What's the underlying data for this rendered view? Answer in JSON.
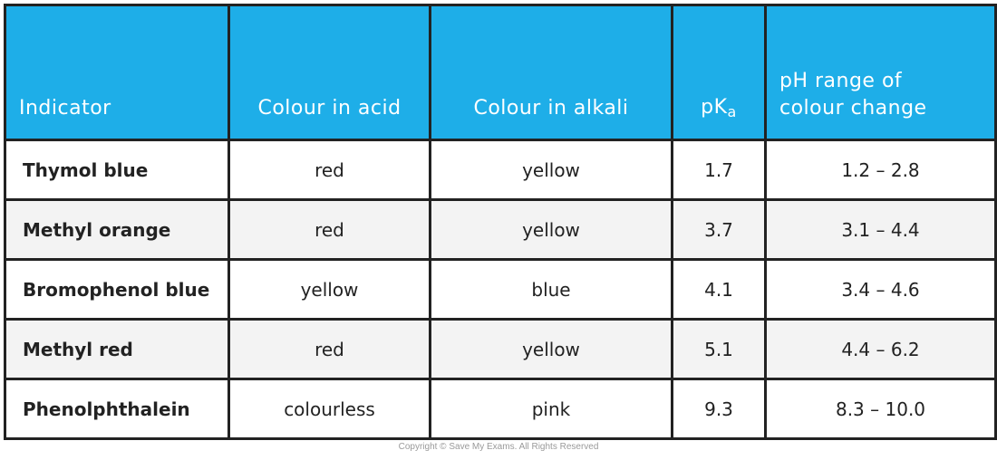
{
  "table": {
    "header_color": "#1eaee8",
    "headers": {
      "indicator": "Indicator",
      "colour_acid": "Colour in acid",
      "colour_alkali": "Colour in alkali",
      "pka_main": "pK",
      "pka_sub": "a",
      "ph_range_line1": "pH range of",
      "ph_range_line2": "colour change"
    },
    "rows": [
      {
        "indicator": "Thymol blue",
        "acid": "red",
        "alkali": "yellow",
        "pka": "1.7",
        "range": "1.2 – 2.8"
      },
      {
        "indicator": "Methyl orange",
        "acid": "red",
        "alkali": "yellow",
        "pka": "3.7",
        "range": "3.1 – 4.4"
      },
      {
        "indicator": "Bromophenol blue",
        "acid": "yellow",
        "alkali": "blue",
        "pka": "4.1",
        "range": "3.4 – 4.6"
      },
      {
        "indicator": "Methyl red",
        "acid": "red",
        "alkali": "yellow",
        "pka": "5.1",
        "range": "4.4 – 6.2"
      },
      {
        "indicator": "Phenolphthalein",
        "acid": "colourless",
        "alkali": "pink",
        "pka": "9.3",
        "range": "8.3 – 10.0"
      }
    ]
  },
  "footer": {
    "copyright": "Copyright © Save My Exams. All Rights Reserved"
  }
}
